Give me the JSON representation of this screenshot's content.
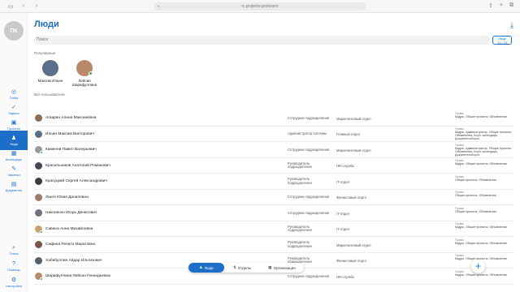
{
  "browser": {
    "url": "rc.projecto.pro/users"
  },
  "sidebar": {
    "avatar_initials": "ПК",
    "top_items": [
      {
        "label": "Today",
        "icon": "target-icon"
      },
      {
        "label": "Задачи",
        "icon": "check-icon"
      },
      {
        "label": "Проекты",
        "icon": "briefcase-icon"
      },
      {
        "label": "Люди",
        "icon": "person-icon",
        "active": true
      },
      {
        "label": "Календарь",
        "icon": "calendar-icon"
      },
      {
        "label": "Заметки",
        "icon": "notes-icon"
      },
      {
        "label": "Документы",
        "icon": "documents-icon"
      }
    ],
    "bottom_items": [
      {
        "label": "Поиск",
        "icon": "search-icon"
      },
      {
        "label": "Помощь",
        "icon": "help-icon"
      },
      {
        "label": "Настройки",
        "icon": "gear-icon"
      }
    ]
  },
  "page": {
    "title": "Люди",
    "search_placeholder": "Поиск",
    "hierarchy_button": {
      "line1": "Люди",
      "line2": "11 / 23"
    },
    "popular_label": "Популярные",
    "all_users_label": "Все пользователи"
  },
  "popular": [
    {
      "name": "Максим Ильин",
      "online": false,
      "color": "#5b6f8a"
    },
    {
      "name": "Лейсан Шарифуллина",
      "online": true,
      "color": "#b98a6a"
    }
  ],
  "rights_label": "Права",
  "users": [
    {
      "name": "Агварян Алина Максимовна",
      "position": "Сотрудник подразделения",
      "department": "Маркетинговый отдел",
      "rights": "Кадры, Общие проекты, Объявления",
      "online": false,
      "color": "#8a6e5a"
    },
    {
      "name": "Ильин Максим Викторович",
      "position": "Администратор системы",
      "department": "Главный отдел",
      "rights": "Кадры, Администратор, Общие проекты, Объявления, Корп. календарь, Документооборот",
      "online": false,
      "color": "#5b6f8a"
    },
    {
      "name": "Каменев Павел Валерьевич",
      "position": "Сотрудник подразделения",
      "department": "Маркетинговый отдел",
      "rights": "Кадры, Администратор, Общие проекты, Объявления, Корп. календарь, Документооборот",
      "online": true,
      "color": "#9a9a9a"
    },
    {
      "name": "Красильников Анатолий Романович",
      "position": "Руководитель подразделения",
      "department": "HR-служба",
      "rights": "Кадры, Общие проекты, Объявления",
      "online": false,
      "color": "#444a55"
    },
    {
      "name": "Красуцкий Сергей Александрович",
      "position": "Руководитель подразделения",
      "department": "IT-отдел",
      "rights": "Общие проекты, Объявления",
      "online": false,
      "color": "#3d3d3d"
    },
    {
      "name": "Ланге Юлия Даниловна",
      "position": "Сотрудник подразделения",
      "department": "Финансовый отдел",
      "rights": "Общие проекты, Объявления",
      "online": false,
      "color": "#a07a68"
    },
    {
      "name": "Никоненко Игорь Денисович",
      "position": "Сотрудник подразделения",
      "department": "IT-отдел",
      "rights": "Общие проекты, Объявления",
      "online": false,
      "color": "#6c7580"
    },
    {
      "name": "Савина Анна Михайловна",
      "position": "Руководитель подразделения",
      "department": "IT-отдел",
      "rights": "Кадры, Общие проекты, Объявления",
      "online": true,
      "color": "#c9a26f"
    },
    {
      "name": "Сафина Рената Маратовна",
      "position": "Руководитель подразделения",
      "department": "Маркетинговый отдел",
      "rights": "Кадры, Общие проекты, Объявления",
      "online": false,
      "color": "#7a5548"
    },
    {
      "name": "Хабибуллин Айдар Ильгизович",
      "position": "Руководитель подразделения",
      "department": "Финансовый отдел",
      "rights": "Кадры, Общие проекты, Объявления",
      "online": false,
      "color": "#55606e"
    },
    {
      "name": "Шарифуллина Лейсан Геннадьевна",
      "position": "Сотрудник подразделения",
      "department": "HR-служба",
      "rights": "Кадры, Общие проекты, Объявления",
      "online": true,
      "color": "#b98a6a"
    }
  ],
  "bottom_tabs": [
    {
      "label": "Люди",
      "icon": "person-icon",
      "active": true
    },
    {
      "label": "Отделы",
      "icon": "departments-icon",
      "active": false
    },
    {
      "label": "Организация",
      "icon": "organization-icon",
      "active": false
    }
  ]
}
